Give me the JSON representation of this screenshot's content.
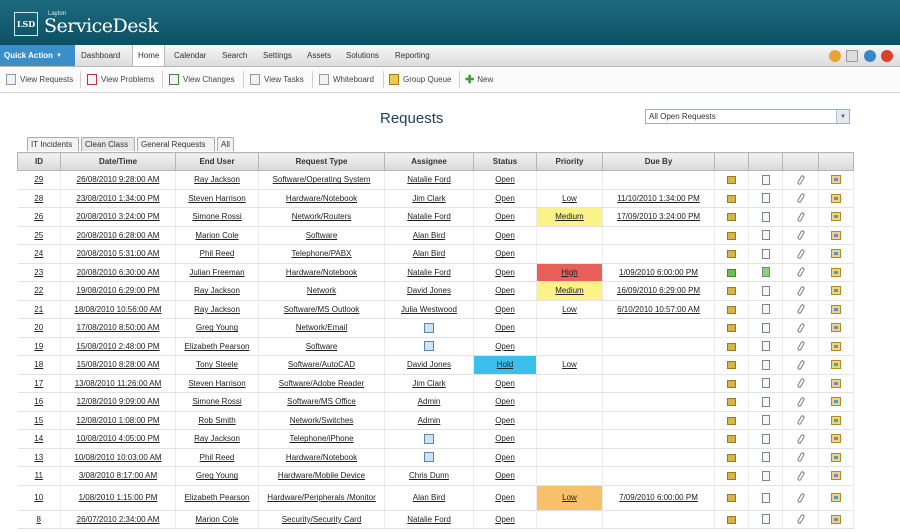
{
  "app": {
    "logo_small": "Layton",
    "logo_text": "ServiceDesk",
    "logo_box": "LSD"
  },
  "menu": {
    "quick_action": "Quick Action",
    "items": [
      "Dashboard",
      "Home",
      "Calendar",
      "Search",
      "Settings",
      "Assets",
      "Solutions",
      "Reporting"
    ],
    "active": "Home"
  },
  "toolbar": {
    "items": [
      "View Requests",
      "View Problems",
      "View Changes",
      "View Tasks",
      "Whiteboard",
      "Group Queue",
      "New"
    ]
  },
  "page": {
    "title": "Requests",
    "filter_value": "All Open Requests"
  },
  "tabs": [
    "IT Incidents",
    "Clean Class",
    "General Requests",
    "All"
  ],
  "columns": [
    "ID",
    "Date/Time",
    "End User",
    "Request Type",
    "Assignee",
    "Status",
    "Priority",
    "Due By"
  ],
  "rows": [
    {
      "id": "29",
      "date": "26/08/2010 9:28:00 AM",
      "user": "Ray Jackson",
      "type": "Software/Operating System",
      "assignee": "Natalie Ford",
      "status": "Open",
      "priority": "",
      "due": ""
    },
    {
      "id": "28",
      "date": "23/08/2010 1:34:00 PM",
      "user": "Steven Harrison",
      "type": "Hardware/Notebook",
      "assignee": "Jim Clark",
      "status": "Open",
      "priority": "Low",
      "due": "11/10/2010 1:34:00 PM"
    },
    {
      "id": "26",
      "date": "20/08/2010 3:24:00 PM",
      "user": "Simone Rossi",
      "type": "Network/Routers",
      "assignee": "Natalie Ford",
      "status": "Open",
      "priority": "Medium",
      "due": "17/09/2010 3:24:00 PM"
    },
    {
      "id": "25",
      "date": "20/08/2010 6:28:00 AM",
      "user": "Marion Cole",
      "type": "Software",
      "assignee": "Alan Bird",
      "status": "Open",
      "priority": "",
      "due": ""
    },
    {
      "id": "24",
      "date": "20/08/2010 5:31:00 AM",
      "user": "Phil Reed",
      "type": "Telephone/PABX",
      "assignee": "Alan Bird",
      "status": "Open",
      "priority": "",
      "due": ""
    },
    {
      "id": "23",
      "date": "20/08/2010 6:30:00 AM",
      "user": "Julian Freeman",
      "type": "Hardware/Notebook",
      "assignee": "Natalie Ford",
      "status": "Open",
      "priority": "High",
      "due": "1/09/2010 6:00:00 PM"
    },
    {
      "id": "22",
      "date": "19/08/2010 6:29:00 PM",
      "user": "Ray Jackson",
      "type": "Network",
      "assignee": "David Jones",
      "status": "Open",
      "priority": "Medium",
      "due": "16/09/2010 6:29:00 PM"
    },
    {
      "id": "21",
      "date": "18/08/2010 10:56:00 AM",
      "user": "Ray Jackson",
      "type": "Software/MS Outlook",
      "assignee": "Julia Westwood",
      "status": "Open",
      "priority": "Low",
      "due": "6/10/2010 10:57:00 AM"
    },
    {
      "id": "20",
      "date": "17/08/2010 8:50:00 AM",
      "user": "Greg Young",
      "type": "Network/Email",
      "assignee": "",
      "status": "Open",
      "priority": "",
      "due": ""
    },
    {
      "id": "19",
      "date": "15/08/2010 2:48:00 PM",
      "user": "Elizabeth Pearson",
      "type": "Software",
      "assignee": "",
      "status": "Open",
      "priority": "",
      "due": ""
    },
    {
      "id": "18",
      "date": "15/08/2010 8:28:00 AM",
      "user": "Tony Steele",
      "type": "Software/AutoCAD",
      "assignee": "David Jones",
      "status": "Hold",
      "priority": "Low",
      "due": ""
    },
    {
      "id": "17",
      "date": "13/08/2010 11:26:00 AM",
      "user": "Steven Harrison",
      "type": "Software/Adobe Reader",
      "assignee": "Jim Clark",
      "status": "Open",
      "priority": "",
      "due": ""
    },
    {
      "id": "16",
      "date": "12/08/2010 9:09:00 AM",
      "user": "Simone Rossi",
      "type": "Software/MS Office",
      "assignee": "Admin",
      "status": "Open",
      "priority": "",
      "due": ""
    },
    {
      "id": "15",
      "date": "12/08/2010 1:08:00 PM",
      "user": "Rob Smith",
      "type": "Network/Switches",
      "assignee": "Admin",
      "status": "Open",
      "priority": "",
      "due": ""
    },
    {
      "id": "14",
      "date": "10/08/2010 4:05:00 PM",
      "user": "Ray Jackson",
      "type": "Telephone/iPhone",
      "assignee": "",
      "status": "Open",
      "priority": "",
      "due": ""
    },
    {
      "id": "13",
      "date": "10/08/2010 10:03:00 AM",
      "user": "Phil Reed",
      "type": "Hardware/Notebook",
      "assignee": "",
      "status": "Open",
      "priority": "",
      "due": ""
    },
    {
      "id": "11",
      "date": "3/08/2010 8:17:00 AM",
      "user": "Greg Young",
      "type": "Hardware/Mobile Device",
      "assignee": "Chris Dunn",
      "status": "Open",
      "priority": "",
      "due": ""
    },
    {
      "id": "10",
      "date": "1/08/2010 1:15:00 PM",
      "user": "Elizabeth Pearson",
      "type": "Hardware/Peripherals /Monitor",
      "assignee": "Alan Bird",
      "status": "Open",
      "priority": "Low",
      "due": "7/09/2010 6:00:00 PM"
    },
    {
      "id": "8",
      "date": "26/07/2010 2:34:00 AM",
      "user": "Marion Cole",
      "type": "Security/Security Card",
      "assignee": "Natalie Ford",
      "status": "Open",
      "priority": "",
      "due": ""
    }
  ],
  "colors": {
    "banner": "#0d4f63",
    "quick_action": "#3b8fc8",
    "priority_high": "#e9605a",
    "priority_medium": "#fbf38a",
    "priority_low": "#f7c06a",
    "status_hold": "#3bc0ee"
  },
  "icons": {
    "row_actions": [
      "note-icon",
      "document-icon",
      "attachment-icon",
      "email-icon"
    ],
    "toolbar": [
      "requests-icon",
      "problems-icon",
      "changes-icon",
      "tasks-icon",
      "whiteboard-icon",
      "group-queue-icon",
      "new-icon"
    ],
    "top_right": [
      "settings-icon",
      "mail-icon",
      "help-icon",
      "power-icon"
    ]
  }
}
